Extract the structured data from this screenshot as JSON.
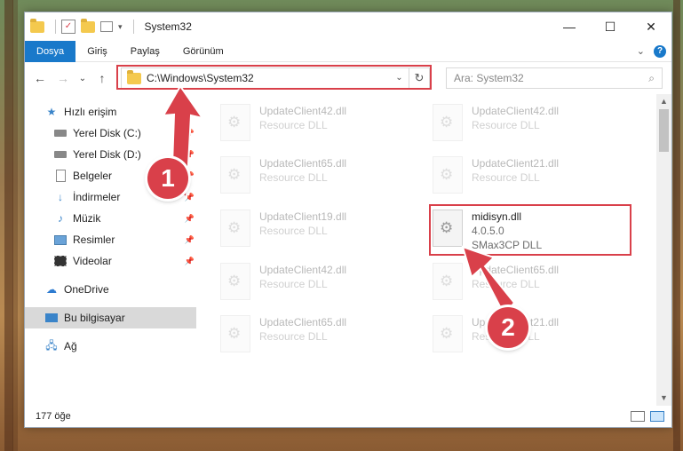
{
  "window": {
    "title": "System32",
    "controls": {
      "minimize": "—",
      "maximize": "☐",
      "close": "✕"
    }
  },
  "ribbon": {
    "tabs": [
      "Dosya",
      "Giriş",
      "Paylaş",
      "Görünüm"
    ],
    "collapse": "⌄",
    "help": "?"
  },
  "navigation": {
    "back": "←",
    "forward": "→",
    "recent": "⌄",
    "up": "↑",
    "address": "C:\\Windows\\System32",
    "address_dropdown": "⌄",
    "refresh": "↻",
    "search_placeholder": "Ara: System32",
    "search_icon": "⌕"
  },
  "sidebar": {
    "quick_access": "Hızlı erişim",
    "items": [
      {
        "label": "Yerel Disk (C:)",
        "icon": "drive-icon"
      },
      {
        "label": "Yerel Disk (D:)",
        "icon": "drive-icon"
      },
      {
        "label": "Belgeler",
        "icon": "documents-icon"
      },
      {
        "label": "İndirmeler",
        "icon": "download-icon"
      },
      {
        "label": "Müzik",
        "icon": "music-icon"
      },
      {
        "label": "Resimler",
        "icon": "pictures-icon"
      },
      {
        "label": "Videolar",
        "icon": "video-icon"
      }
    ],
    "onedrive": "OneDrive",
    "this_pc": "Bu bilgisayar",
    "network": "Ağ"
  },
  "files": [
    {
      "name": "UpdateClient42.dll",
      "type": "Resource DLL",
      "faded": true
    },
    {
      "name": "UpdateClient42.dll",
      "type": "Resource DLL",
      "faded": true
    },
    {
      "name": "UpdateClient65.dll",
      "type": "Resource DLL",
      "faded": true
    },
    {
      "name": "UpdateClient21.dll",
      "type": "Resource DLL",
      "faded": true
    },
    {
      "name": "UpdateClient19.dll",
      "type": "Resource DLL",
      "faded": true
    },
    {
      "name": "midisyn.dll",
      "version": "4.0.5.0",
      "type": "SMax3CP DLL",
      "faded": false
    },
    {
      "name": "UpdateClient42.dll",
      "type": "Resource DLL",
      "faded": true
    },
    {
      "name": "UpdateClient65.dll",
      "type": "Resource DLL",
      "faded": true
    },
    {
      "name": "UpdateClient65.dll",
      "type": "Resource DLL",
      "faded": true
    },
    {
      "name": "UpdateClient21.dll",
      "type": "Resource DLL",
      "faded": true
    }
  ],
  "status": {
    "count": "177 öğe"
  },
  "annotations": {
    "step1": "1",
    "step2": "2",
    "color": "#d9404a"
  }
}
